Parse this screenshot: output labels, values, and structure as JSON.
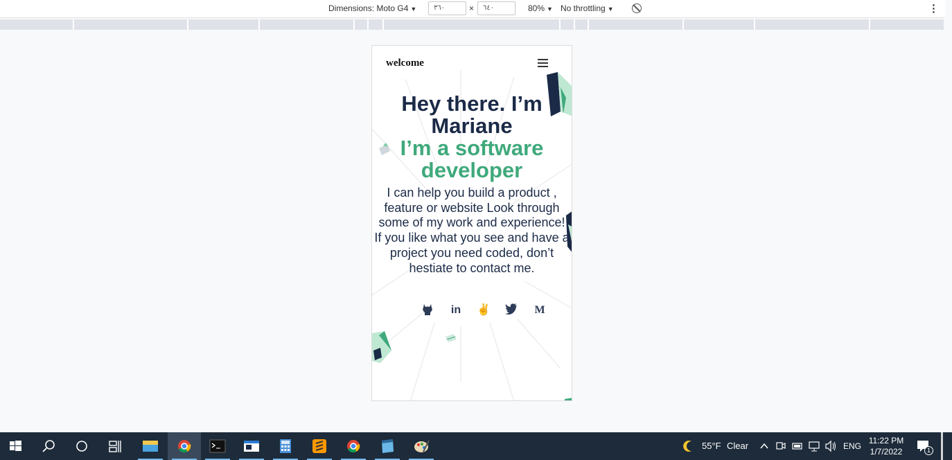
{
  "devtools": {
    "dimensions_label": "Dimensions: Moto G4",
    "width_value": "٣٦٠",
    "height_value": "٦٤٠",
    "times": "×",
    "zoom": "80%",
    "throttling": "No throttling",
    "more": "⋮"
  },
  "site": {
    "brand": "welcome",
    "heading_line1": "Hey there. I’m",
    "heading_line2": "Mariane",
    "subheading_line1": "I’m a software",
    "subheading_line2": "developer",
    "intro": [
      "I can help you build a product ,",
      "feature or website Look through",
      "some of my work and experience!",
      "If you like what you see and have a",
      "project you need coded, don’t",
      "hestiate to contact me."
    ],
    "social": [
      {
        "name": "github",
        "glyph": "🐱"
      },
      {
        "name": "linkedin",
        "glyph": "in"
      },
      {
        "name": "angellist",
        "glyph": "✌"
      },
      {
        "name": "twitter",
        "glyph": "🐦"
      },
      {
        "name": "medium",
        "glyph": "M"
      }
    ]
  },
  "taskbar": {
    "weather_temp": "55°F",
    "weather_cond": "Clear",
    "language": "ENG",
    "time": "11:22 PM",
    "date": "1/7/2022",
    "notification_count": "1"
  },
  "colors": {
    "heading": "#1b2a47",
    "accent": "#3fa97b",
    "taskbar": "#1d2b3a"
  }
}
